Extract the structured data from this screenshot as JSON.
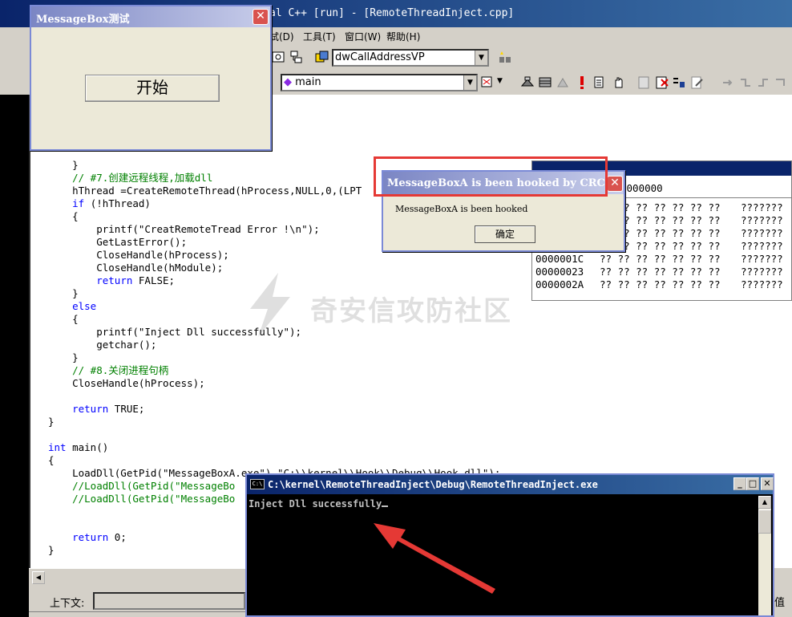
{
  "ide": {
    "title": "al C++ [run] - [RemoteThreadInject.cpp]",
    "menu": [
      "试(D)",
      "工具(T)",
      "窗口(W)",
      "帮助(H)"
    ],
    "combo_function": "dwCallAddressVP",
    "combo_scope": "main",
    "context_label": "上下文:",
    "right_fragment": "值"
  },
  "code": {
    "lines": [
      {
        "t": "    }",
        "c": ""
      },
      {
        "t": "    // #7.创建远程线程,加载dll",
        "c": "cm"
      },
      {
        "t": "    hThread =CreateRemoteThread(hProcess,NULL,0,(LPT",
        "c": ""
      },
      {
        "t": "    if (!hThread)",
        "c": "if"
      },
      {
        "t": "    {",
        "c": ""
      },
      {
        "t": "        printf(\"CreatRemoteTread Error !\\n\");",
        "c": ""
      },
      {
        "t": "        GetLastError();",
        "c": ""
      },
      {
        "t": "        CloseHandle(hProcess);",
        "c": ""
      },
      {
        "t": "        CloseHandle(hModule);",
        "c": ""
      },
      {
        "t": "        return FALSE;",
        "c": "return"
      },
      {
        "t": "    }",
        "c": ""
      },
      {
        "t": "    else",
        "c": "kw"
      },
      {
        "t": "    {",
        "c": ""
      },
      {
        "t": "        printf(\"Inject Dll successfully\");",
        "c": ""
      },
      {
        "t": "        getchar();",
        "c": ""
      },
      {
        "t": "    }",
        "c": ""
      },
      {
        "t": "    // #8.关闭进程句柄",
        "c": "cm"
      },
      {
        "t": "    CloseHandle(hProcess);",
        "c": ""
      },
      {
        "t": "",
        "c": ""
      },
      {
        "t": "    return TRUE;",
        "c": "return"
      },
      {
        "t": "}",
        "c": ""
      },
      {
        "t": "",
        "c": ""
      },
      {
        "t": "int main()",
        "c": "int"
      },
      {
        "t": "{",
        "c": ""
      },
      {
        "t": "    LoadDll(GetPid(\"MessageBoxA.exe\"),\"C:\\\\kernel\\\\Hook\\\\Debug\\\\Hook.dll\");",
        "c": ""
      },
      {
        "t": "    //LoadDll(GetPid(\"MessageBo",
        "c": "cm"
      },
      {
        "t": "    //LoadDll(GetPid(\"MessageBo",
        "c": "cm"
      },
      {
        "t": "",
        "c": ""
      },
      {
        "t": "",
        "c": ""
      },
      {
        "t": "    return 0;",
        "c": "return"
      },
      {
        "t": "}",
        "c": ""
      }
    ]
  },
  "memory": {
    "address_value": "0000000",
    "rows": [
      {
        "addr": "",
        "bytes": "?? ?? ?? ?? ?? ?? ??",
        "ascii": "???????"
      },
      {
        "addr": "",
        "bytes": "?? ?? ?? ?? ?? ?? ??",
        "ascii": "???????"
      },
      {
        "addr": "",
        "bytes": "?? ?? ?? ?? ?? ?? ??",
        "ascii": "???????"
      },
      {
        "addr": "",
        "bytes": "?? ?? ?? ?? ?? ?? ??",
        "ascii": "???????"
      },
      {
        "addr": "0000001C",
        "bytes": "?? ?? ?? ?? ?? ?? ??",
        "ascii": "???????"
      },
      {
        "addr": "00000023",
        "bytes": "?? ?? ?? ?? ?? ?? ??",
        "ascii": "???????"
      },
      {
        "addr": "0000002A",
        "bytes": "?? ?? ?? ?? ?? ?? ??",
        "ascii": "???????"
      }
    ]
  },
  "msgtest": {
    "title": "MessageBox测试",
    "start_label": "开始",
    "close_glyph": "✕"
  },
  "hooked": {
    "title": "MessageBoxA is been hooked by CRC",
    "text": "MessageBoxA is been hooked",
    "ok_label": "确定",
    "close_glyph": "✕"
  },
  "console": {
    "title": "C:\\kernel\\RemoteThreadInject\\Debug\\RemoteThreadInject.exe",
    "icon_text": "C:\\",
    "output": "Inject Dll successfully",
    "min_glyph": "_",
    "max_glyph": "□",
    "close_glyph": "✕"
  },
  "watermark": {
    "text": "奇安信攻防社区"
  },
  "colors": {
    "highlight": "#e53935",
    "arrow": "#e53935",
    "code_comment": "#008000",
    "code_keyword": "#0000ff"
  }
}
